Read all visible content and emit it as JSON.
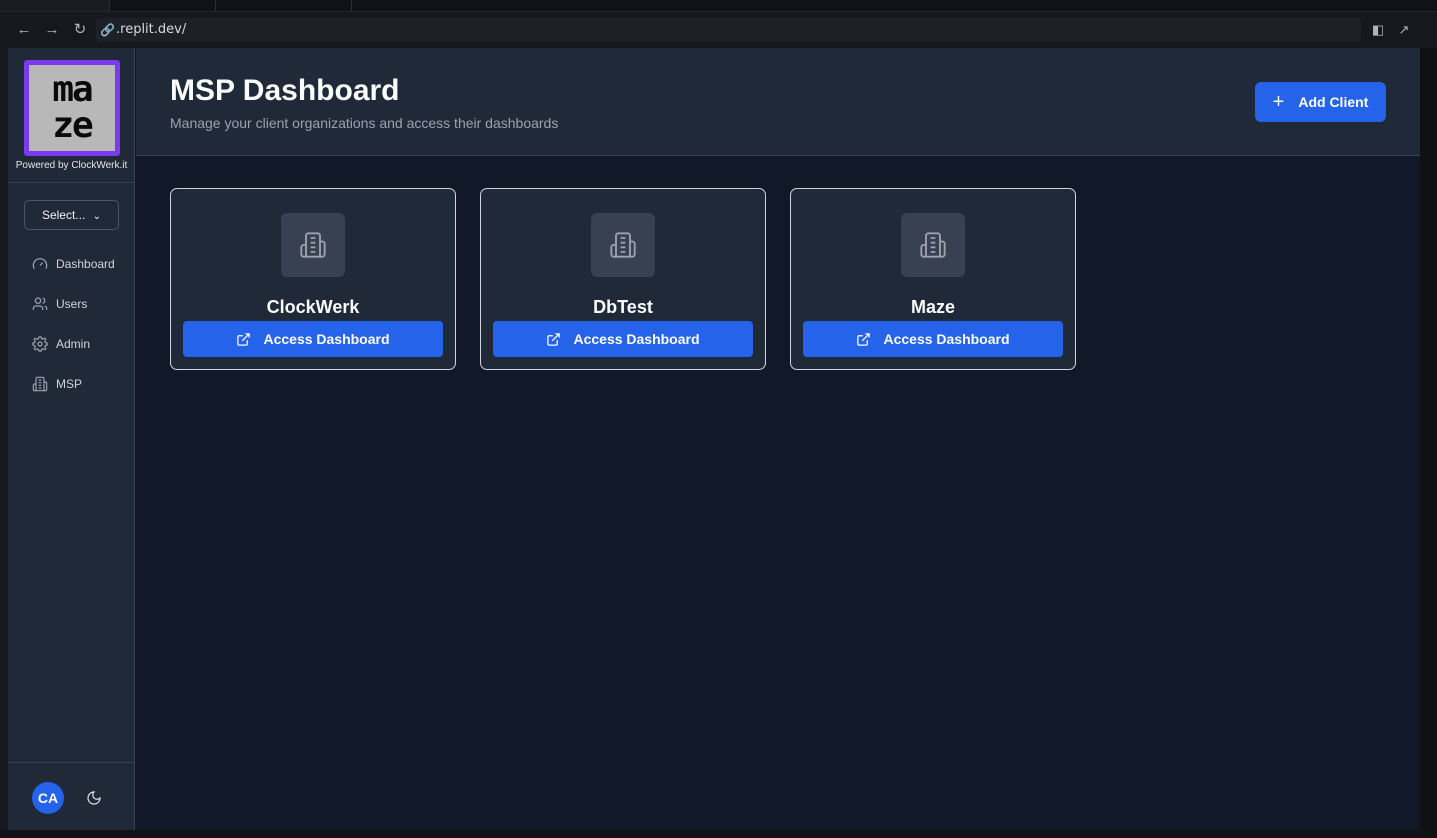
{
  "browser": {
    "url": ".replit.dev/",
    "back_icon": "arrow-left-icon",
    "forward_icon": "arrow-right-icon",
    "reload_icon": "reload-icon"
  },
  "sidebar": {
    "logo_top": "ma",
    "logo_bottom": "ze",
    "powered_by": "Powered by ClockWerk.it",
    "select_label": "Select...",
    "items": [
      {
        "label": "Dashboard",
        "icon": "gauge-icon"
      },
      {
        "label": "Users",
        "icon": "users-icon"
      },
      {
        "label": "Admin",
        "icon": "gear-icon"
      },
      {
        "label": "MSP",
        "icon": "building-icon"
      }
    ],
    "avatar_initials": "CA",
    "theme_icon": "moon-icon"
  },
  "header": {
    "title": "MSP Dashboard",
    "subtitle": "Manage your client organizations and access their dashboards",
    "add_button": "Add Client"
  },
  "clients": [
    {
      "name": "ClockWerk",
      "button": "Access Dashboard"
    },
    {
      "name": "DbTest",
      "button": "Access Dashboard"
    },
    {
      "name": "Maze",
      "button": "Access Dashboard"
    }
  ],
  "colors": {
    "accent": "#2563eb",
    "logo_border": "#7c3aed",
    "background": "#111827",
    "panel": "#1f2937"
  }
}
